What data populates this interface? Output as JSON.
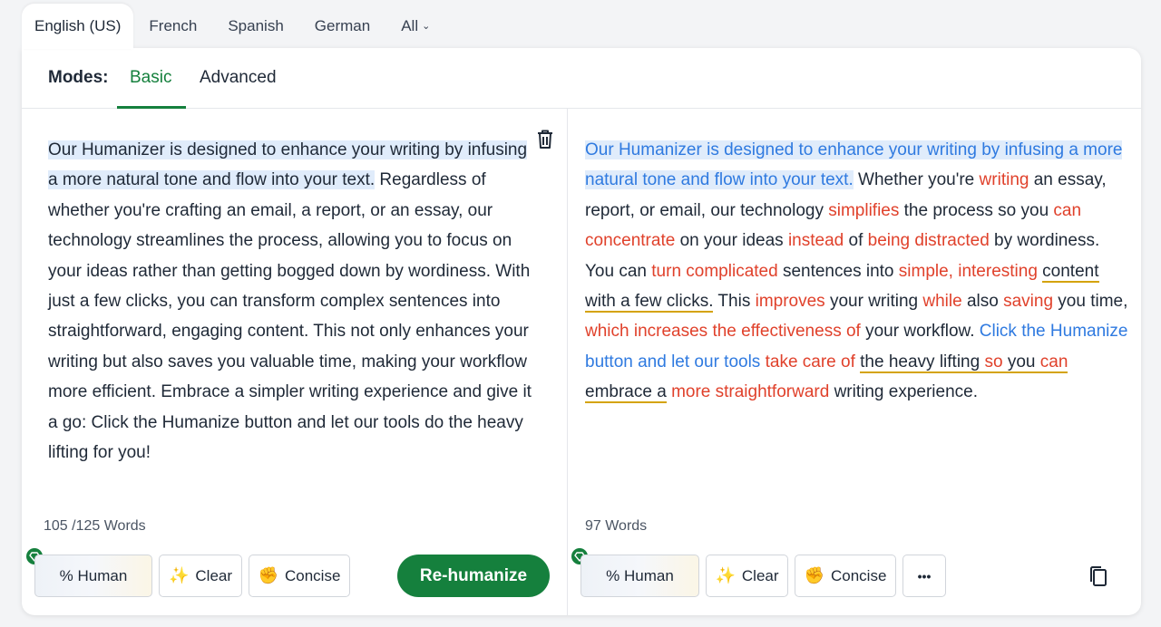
{
  "language_tabs": [
    {
      "label": "English (US)",
      "active": true
    },
    {
      "label": "French"
    },
    {
      "label": "Spanish"
    },
    {
      "label": "German"
    },
    {
      "label": "All"
    }
  ],
  "modes": {
    "label": "Modes:",
    "basic": "Basic",
    "advanced": "Advanced",
    "selected": "Basic"
  },
  "left_pane": {
    "text_highlighted": "Our Humanizer is designed to enhance your writing by infusing a more natural tone and flow into your text.",
    "text_rest": " Regardless of whether you're crafting an email, a report, or an essay, our technology streamlines the process, allowing you to focus on your ideas rather than getting bogged down by wordiness. With just a few clicks, you can transform complex sentences into straightforward, engaging content. This not only enhances your writing but also saves you valuable time, making your workflow more efficient. Embrace a simpler writing experience and give it a go: Click the Humanize button and let our tools do the heavy lifting for you!",
    "word_count": "105 /125 Words",
    "buttons": {
      "human": "% Human",
      "clear": "Clear",
      "concise": "Concise",
      "rehumanize": "Re-humanize"
    }
  },
  "right_pane": {
    "segments": [
      {
        "text": "Our Humanizer is designed to enhance your writing by infusing a more natural tone and flow into your text.",
        "style": "hl-blue"
      },
      {
        "text": " Whether you're ",
        "style": ""
      },
      {
        "text": "writing",
        "style": "red"
      },
      {
        "text": " an essay, report, or email, our technology ",
        "style": ""
      },
      {
        "text": "simplifies",
        "style": "red"
      },
      {
        "text": " the process so you ",
        "style": ""
      },
      {
        "text": "can concentrate",
        "style": "red"
      },
      {
        "text": " on your ideas ",
        "style": ""
      },
      {
        "text": "instead",
        "style": "red"
      },
      {
        "text": " of ",
        "style": ""
      },
      {
        "text": "being distracted",
        "style": "red"
      },
      {
        "text": " by wordiness. You can ",
        "style": ""
      },
      {
        "text": "turn complicated",
        "style": "red"
      },
      {
        "text": " sentences into ",
        "style": ""
      },
      {
        "text": "simple, interesting",
        "style": "red"
      },
      {
        "text": " ",
        "style": ""
      },
      {
        "text": "content with a few clicks.",
        "style": "ul"
      },
      {
        "text": " This ",
        "style": ""
      },
      {
        "text": "improves",
        "style": "red"
      },
      {
        "text": " your writing ",
        "style": ""
      },
      {
        "text": "while",
        "style": "red"
      },
      {
        "text": " also ",
        "style": ""
      },
      {
        "text": "saving",
        "style": "red"
      },
      {
        "text": " you time, ",
        "style": ""
      },
      {
        "text": "which increases the effectiveness of",
        "style": "red"
      },
      {
        "text": " your workflow. ",
        "style": ""
      },
      {
        "text": "Click the Humanize button and let our tools",
        "style": "blue"
      },
      {
        "text": " ",
        "style": ""
      },
      {
        "text": "take care of",
        "style": "red"
      },
      {
        "text": " ",
        "style": ""
      },
      {
        "text": "the heavy lifting ",
        "style": "ul"
      },
      {
        "text": "so",
        "style": "ul red"
      },
      {
        "text": " you ",
        "style": "ul"
      },
      {
        "text": "can",
        "style": "ul red"
      },
      {
        "text": " embrace a",
        "style": "ul"
      },
      {
        "text": " ",
        "style": ""
      },
      {
        "text": "more straightforward",
        "style": "red"
      },
      {
        "text": " writing experience.",
        "style": ""
      }
    ],
    "word_count": "97 Words",
    "buttons": {
      "human": "% Human",
      "clear": "Clear",
      "concise": "Concise",
      "more": "•••"
    }
  },
  "icons": {
    "trash": "trash-icon",
    "copy": "copy-icon",
    "gem": "gem-icon",
    "sparkle": "sparkle-icon",
    "fist": "fist-icon",
    "chevron": "chevron-down-icon"
  },
  "colors": {
    "accent_green": "#15803d",
    "blue_text": "#2f7ae0",
    "red_text": "#e0412b",
    "underline": "#d4a30a",
    "highlight": "#e0ecfb"
  }
}
